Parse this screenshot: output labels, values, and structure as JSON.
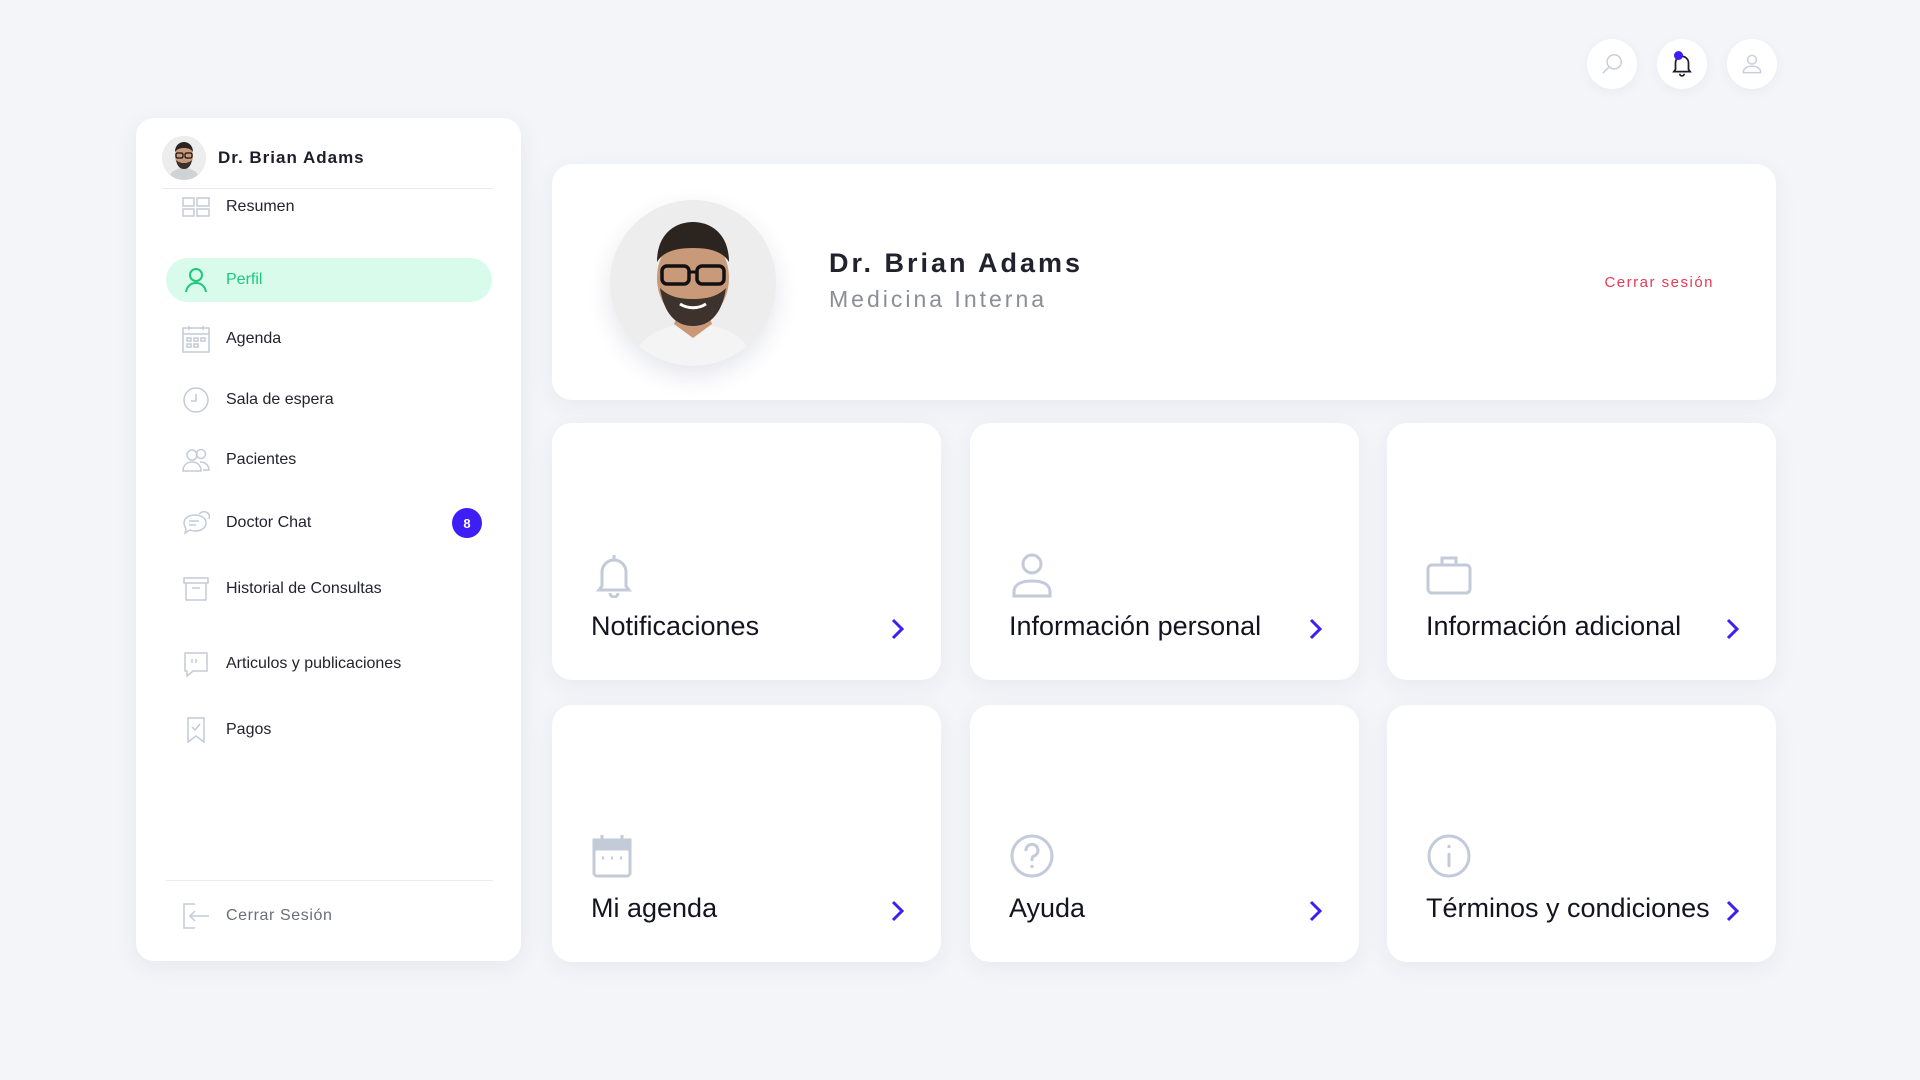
{
  "user": {
    "name": "Dr. Brian Adams",
    "specialty": "Medicina Interna"
  },
  "header": {
    "icons": [
      "search-icon",
      "bell-icon",
      "user-icon"
    ]
  },
  "sidebar": {
    "items": [
      {
        "label": "Resumen",
        "icon": "dashboard-icon"
      },
      {
        "label": "Perfil",
        "icon": "user-icon",
        "active": true
      },
      {
        "label": "Agenda",
        "icon": "calendar-icon"
      },
      {
        "label": "Sala de espera",
        "icon": "clock-icon"
      },
      {
        "label": "Pacientes",
        "icon": "patients-icon"
      },
      {
        "label": "Doctor Chat",
        "icon": "chat-icon",
        "badge": "8"
      },
      {
        "label": "Historial de Consultas",
        "icon": "archive-icon"
      },
      {
        "label": "Articulos y publicaciones",
        "icon": "quote-icon"
      },
      {
        "label": "Pagos",
        "icon": "receipt-icon"
      }
    ],
    "logout_label": "Cerrar Sesión"
  },
  "profile_card": {
    "logout_label": "Cerrar sesión"
  },
  "tiles": [
    {
      "label": "Notificaciones",
      "icon": "bell-icon"
    },
    {
      "label": "Información personal",
      "icon": "user-icon"
    },
    {
      "label": "Información adicional",
      "icon": "briefcase-icon"
    },
    {
      "label": "Mi agenda",
      "icon": "calendar-icon"
    },
    {
      "label": "Ayuda",
      "icon": "help-icon"
    },
    {
      "label": "Términos y condiciones",
      "icon": "info-icon"
    }
  ],
  "colors": {
    "accent": "#3d1ef5",
    "active_green": "#1cc87a",
    "active_bg": "#d8fbec",
    "logout_red": "#e83a55",
    "icon_gray": "#c3cad8"
  }
}
